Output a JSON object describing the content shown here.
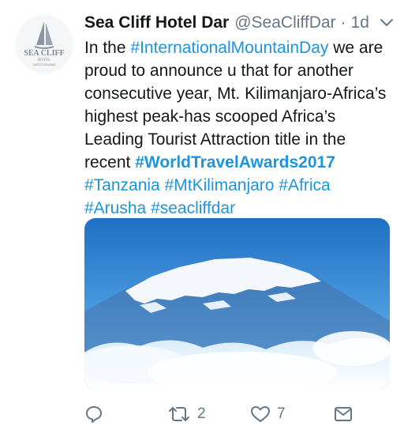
{
  "tweet": {
    "author_name": "Sea Cliff Hotel Dar",
    "author_handle": "@SeaCliffDar",
    "separator": "·",
    "time": "1d",
    "avatar_logo": "SEA CLIFF HOTEL DAR ES SALAAM",
    "lines": [
      [
        {
          "t": "In the ",
          "type": "text"
        },
        {
          "t": "#InternationalMountainDay",
          "type": "tag"
        },
        {
          "t": " we are",
          "type": "text"
        }
      ],
      [
        {
          "t": "proud to announce u that for another",
          "type": "text"
        }
      ],
      [
        {
          "t": "consecutive year, Mt. Kilimanjaro-Africa’s",
          "type": "text"
        }
      ],
      [
        {
          "t": "highest peak-has scooped Africa’s",
          "type": "text"
        }
      ],
      [
        {
          "t": "Leading Tourist Attraction title in the",
          "type": "text"
        }
      ],
      [
        {
          "t": "recent ",
          "type": "text"
        },
        {
          "t": "#WorldTravelAwards2017",
          "type": "tagbold"
        }
      ],
      [
        {
          "t": "#Tanzania",
          "type": "tag"
        },
        {
          "t": " ",
          "type": "text"
        },
        {
          "t": "#MtKilimanjaro",
          "type": "tag"
        },
        {
          "t": " ",
          "type": "text"
        },
        {
          "t": "#Africa",
          "type": "tag"
        }
      ],
      [
        {
          "t": "#Arusha",
          "type": "tag"
        },
        {
          "t": " ",
          "type": "text"
        },
        {
          "t": "#seacliffdar",
          "type": "tag"
        }
      ]
    ],
    "media_subject": "Mt. Kilimanjaro snow-capped peak above clouds",
    "actions": {
      "reply_icon": "reply-icon",
      "retweet_icon": "retweet-icon",
      "retweet_count": "2",
      "like_icon": "heart-icon",
      "like_count": "7",
      "dm_icon": "envelope-icon"
    },
    "colors": {
      "link": "#1b95e0",
      "secondary": "#657786",
      "text": "#14171a"
    }
  }
}
